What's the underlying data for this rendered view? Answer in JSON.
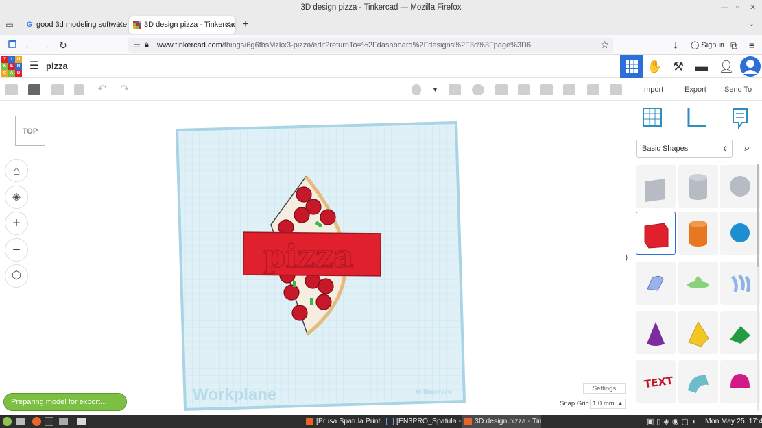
{
  "window": {
    "title": "3D design pizza - Tinkercad — Mozilla Firefox"
  },
  "tabs": [
    {
      "label": "good 3d modeling software"
    },
    {
      "label": "3D design pizza - Tinkercad"
    }
  ],
  "url": {
    "domain": "www.tinkercad.com",
    "path": "/things/6g6fbsMzkx3-pizza/edit?returnTo=%2Fdashboard%2Fdesigns%2F3d%3Fpage%3D6"
  },
  "browser": {
    "signin_label": "Sign in"
  },
  "app": {
    "design_name": "pizza",
    "logo_letters": [
      "TIN",
      "KER",
      "CAD"
    ]
  },
  "toolbar": {
    "import_label": "Import",
    "export_label": "Export",
    "sendto_label": "Send To"
  },
  "view": {
    "cube_label": "TOP"
  },
  "workplane": {
    "label": "Workplane",
    "units": "Millimeters",
    "text_on_shape": "pizza"
  },
  "settings": {
    "settings_label": "Settings",
    "snap_grid_label": "Snap Grid",
    "snap_grid_value": "1.0 mm"
  },
  "status": {
    "export_progress_text": "Preparing model for export..."
  },
  "panel": {
    "shape_category": "Basic Shapes"
  },
  "taskbar": {
    "items": [
      "[Prusa Spatula Print...",
      "[EN3PRO_Spatula - ...",
      "3D design pizza - Tin..."
    ],
    "clock": "Mon May 25, 17:42"
  },
  "colors": {
    "accent": "#2c6fd9",
    "brand_red": "#e0212d",
    "plane": "#cfe9f3",
    "progress": "#7bc043"
  }
}
